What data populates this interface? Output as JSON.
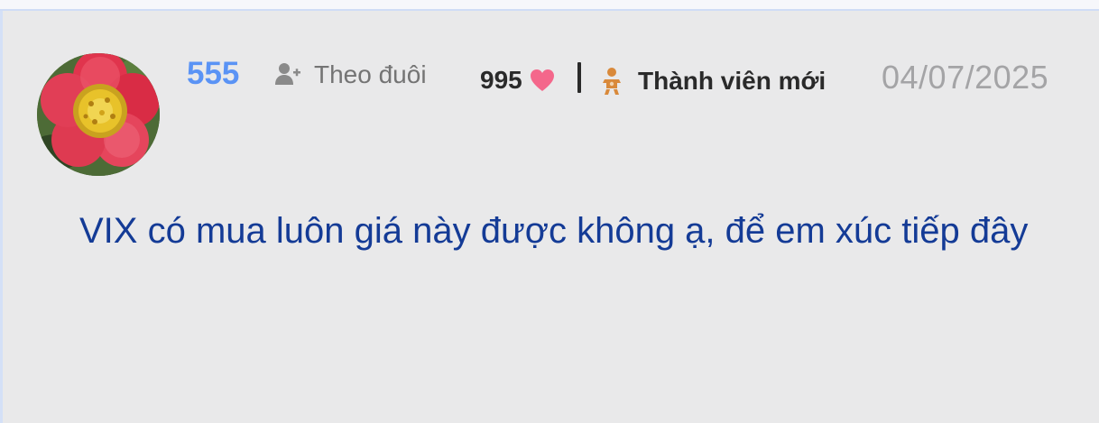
{
  "post": {
    "username": "555",
    "follow_label": "Theo đuôi",
    "like_count": "995",
    "member_badge": "Thành viên mới",
    "date": "04/07/2025",
    "content": "VIX có mua luôn giá này được không ạ, để em xúc tiếp đây"
  },
  "icons": {
    "avatar": "red-flower-avatar",
    "follow": "user-plus-icon",
    "like": "heart-icon",
    "member": "baby-icon"
  },
  "colors": {
    "username": "#5a93f5",
    "content": "#143b96",
    "heart": "#f4678b",
    "member_icon": "#d9893a",
    "date": "#a4a4a6",
    "background": "#e9e9ea"
  }
}
